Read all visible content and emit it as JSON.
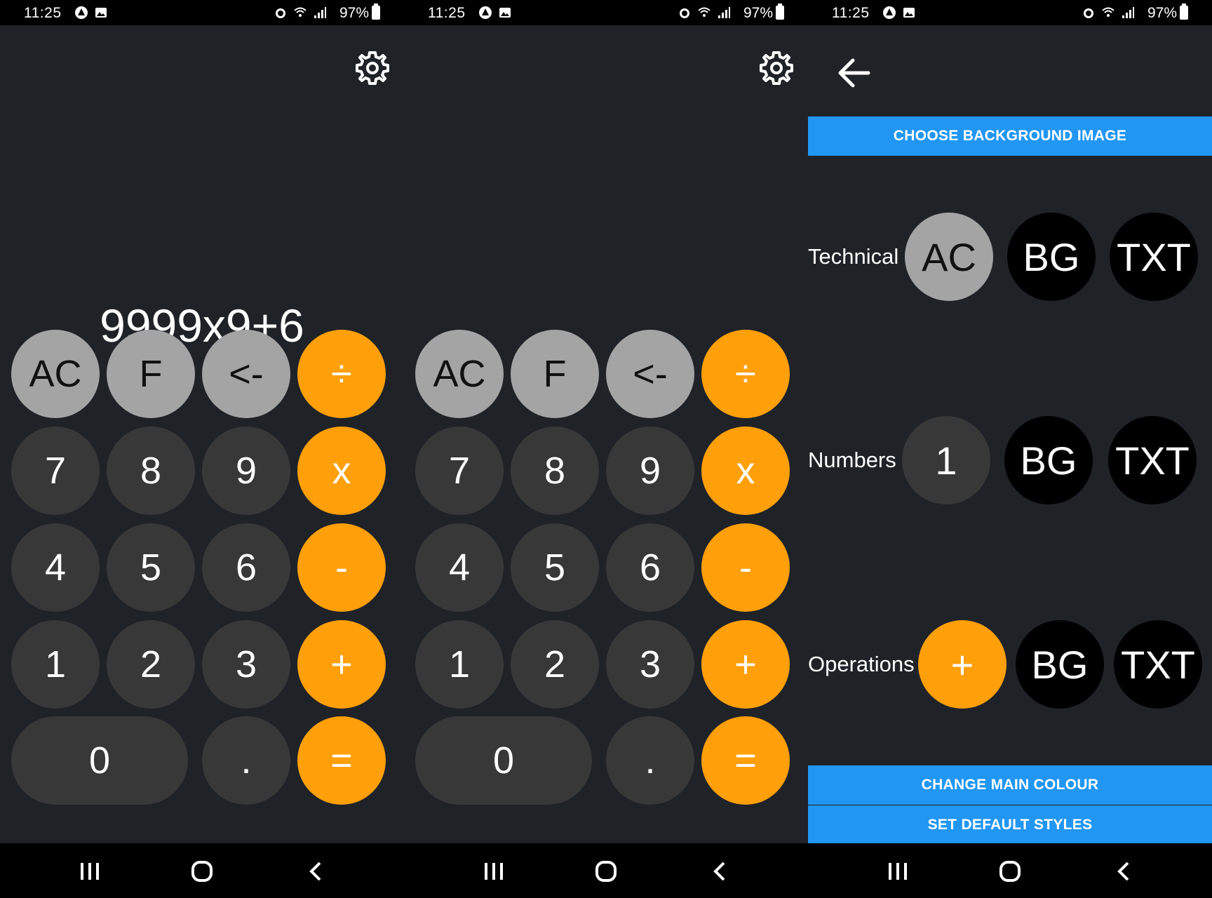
{
  "status_bar": {
    "time": "11:25",
    "battery": "97%"
  },
  "calculator": {
    "display": "9999x9+6",
    "rows": [
      [
        {
          "label": "AC",
          "type": "tech"
        },
        {
          "label": "F",
          "type": "tech"
        },
        {
          "label": "<-",
          "type": "tech"
        },
        {
          "label": "÷",
          "type": "op"
        }
      ],
      [
        {
          "label": "7",
          "type": "num"
        },
        {
          "label": "8",
          "type": "num"
        },
        {
          "label": "9",
          "type": "num"
        },
        {
          "label": "x",
          "type": "op"
        }
      ],
      [
        {
          "label": "4",
          "type": "num"
        },
        {
          "label": "5",
          "type": "num"
        },
        {
          "label": "6",
          "type": "num"
        },
        {
          "label": "-",
          "type": "op"
        }
      ],
      [
        {
          "label": "1",
          "type": "num"
        },
        {
          "label": "2",
          "type": "num"
        },
        {
          "label": "3",
          "type": "num"
        },
        {
          "label": "+",
          "type": "op"
        }
      ],
      [
        {
          "label": "0",
          "type": "num"
        },
        {
          "label": ".",
          "type": "num"
        },
        {
          "label": "=",
          "type": "op"
        }
      ]
    ]
  },
  "settings": {
    "choose_background": "CHOOSE BACKGROUND IMAGE",
    "sections": [
      {
        "label": "Technical",
        "sample": "AC",
        "bg": "BG",
        "txt": "TXT"
      },
      {
        "label": "Numbers",
        "sample": "1",
        "bg": "BG",
        "txt": "TXT"
      },
      {
        "label": "Operations",
        "sample": "+",
        "bg": "BG",
        "txt": "TXT"
      }
    ],
    "change_main_colour": "CHANGE MAIN COLOUR",
    "set_default_styles": "SET DEFAULT STYLES"
  },
  "colors": {
    "background": "#1f2328",
    "technical": "#a4a4a4",
    "number": "#383838",
    "operation": "#ff9f0a",
    "accent_blue": "#2196f3"
  },
  "icons": {
    "settings": "gear-icon",
    "back": "arrow-left-icon",
    "recent_apps": "recent-apps-icon",
    "home": "home-icon",
    "nav_back": "chevron-left-icon"
  }
}
